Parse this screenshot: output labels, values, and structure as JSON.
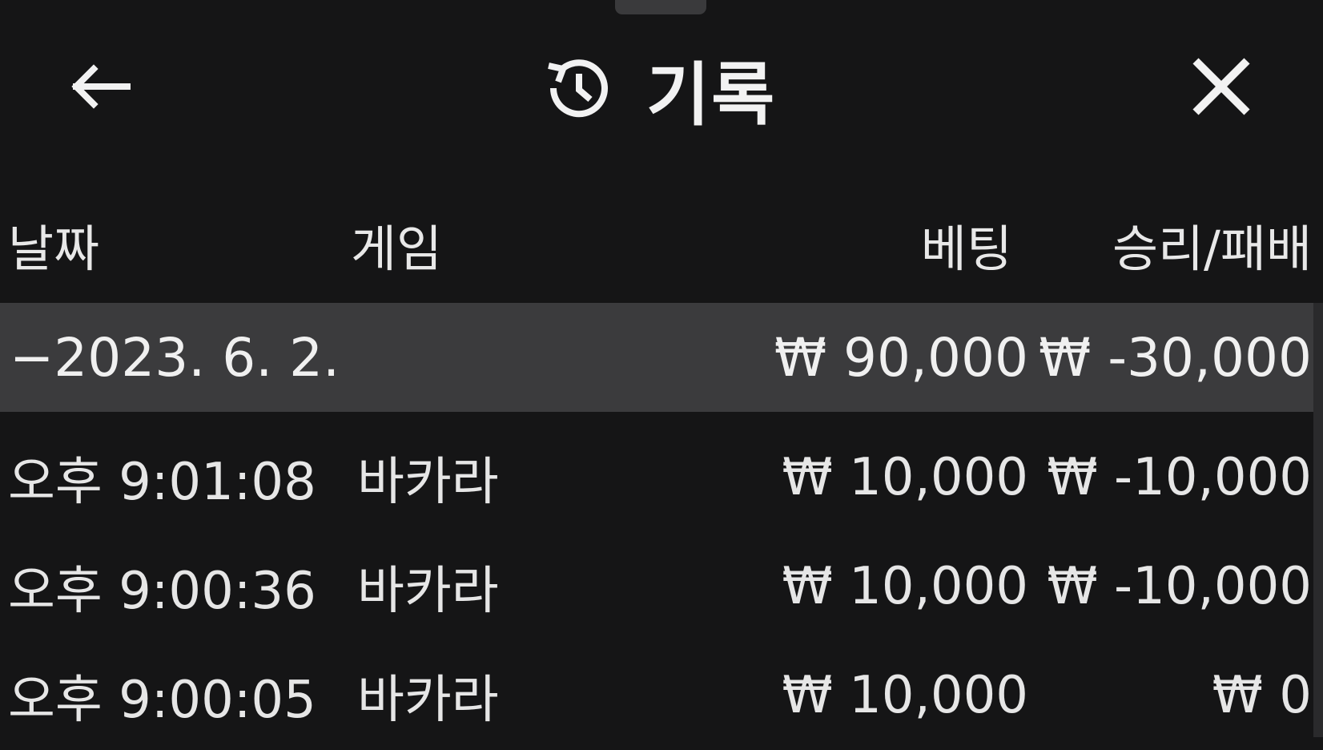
{
  "header": {
    "title": "기록",
    "back_icon": "arrow-left-icon",
    "history_icon": "history-icon",
    "close_icon": "close-icon"
  },
  "columns": {
    "date": "날짜",
    "game": "게임",
    "bet": "베팅",
    "result": "승리/패배"
  },
  "group": {
    "date": "−2023. 6. 2.",
    "bet": "₩ 90,000",
    "result": "₩ -30,000"
  },
  "rows": [
    {
      "time": "오후 9:01:08",
      "game": "바카라",
      "bet": "₩ 10,000",
      "result": "₩ -10,000"
    },
    {
      "time": "오후 9:00:36",
      "game": "바카라",
      "bet": "₩ 10,000",
      "result": "₩ -10,000"
    },
    {
      "time": "오후 9:00:05",
      "game": "바카라",
      "bet": "₩ 10,000",
      "result": "₩ 0"
    }
  ],
  "colors": {
    "background": "#151516",
    "group_row": "#3b3b3d",
    "text": "#e6e6e6"
  }
}
